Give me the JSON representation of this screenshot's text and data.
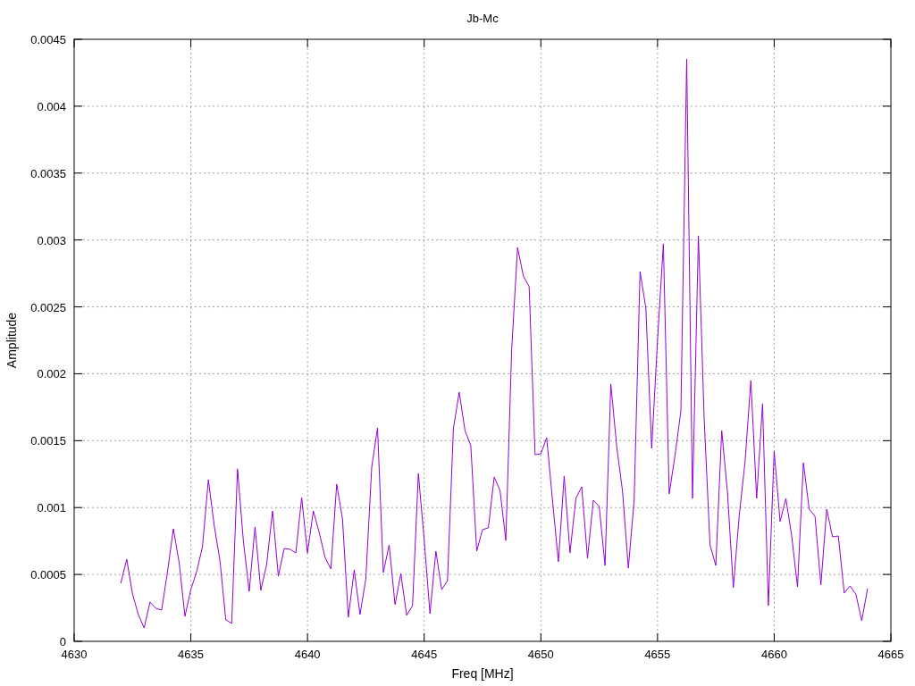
{
  "chart_data": {
    "type": "line",
    "title": "Jb-Mc",
    "xlabel": "Freq [MHz]",
    "ylabel": "Amplitude",
    "x": [
      4632,
      4632.25,
      4632.5,
      4632.75,
      4633,
      4633.25,
      4633.5,
      4633.75,
      4634,
      4634.25,
      4634.5,
      4634.75,
      4635,
      4635.25,
      4635.5,
      4635.75,
      4636,
      4636.25,
      4636.5,
      4636.75,
      4637,
      4637.25,
      4637.5,
      4637.75,
      4638,
      4638.25,
      4638.5,
      4638.75,
      4639,
      4639.25,
      4639.5,
      4639.75,
      4640,
      4640.25,
      4640.5,
      4640.75,
      4641,
      4641.25,
      4641.5,
      4641.75,
      4642,
      4642.25,
      4642.5,
      4642.75,
      4643,
      4643.25,
      4643.5,
      4643.75,
      4644,
      4644.25,
      4644.5,
      4644.75,
      4645,
      4645.25,
      4645.5,
      4645.75,
      4646,
      4646.25,
      4646.5,
      4646.75,
      4647,
      4647.25,
      4647.5,
      4647.75,
      4648,
      4648.25,
      4648.5,
      4648.75,
      4649,
      4649.25,
      4649.5,
      4649.75,
      4650,
      4650.25,
      4650.5,
      4650.75,
      4651,
      4651.25,
      4651.5,
      4651.75,
      4652,
      4652.25,
      4652.5,
      4652.75,
      4653,
      4653.25,
      4653.5,
      4653.75,
      4654,
      4654.25,
      4654.5,
      4654.75,
      4655,
      4655.25,
      4655.5,
      4655.75,
      4656,
      4656.25,
      4656.5,
      4656.75,
      4657,
      4657.25,
      4657.5,
      4657.75,
      4658,
      4658.25,
      4658.5,
      4658.75,
      4659,
      4659.25,
      4659.5,
      4659.75,
      4660,
      4660.25,
      4660.5,
      4660.75,
      4661,
      4661.25,
      4661.5,
      4661.75,
      4662,
      4662.25,
      4662.5,
      4662.75,
      4663,
      4663.25,
      4663.5,
      4663.75,
      4664
    ],
    "series": [
      {
        "color": "#9400d3",
        "values": [
          0.000434,
          0.000614,
          0.000354,
          0.0002,
          0.0001,
          0.000294,
          0.000247,
          0.000234,
          0.000521,
          0.000841,
          0.000588,
          0.000187,
          0.000387,
          0.000521,
          0.000708,
          0.001208,
          0.000868,
          0.000601,
          0.00016,
          0.000134,
          0.001289,
          0.000754,
          0.000374,
          0.000855,
          0.000381,
          0.000574,
          0.000975,
          0.000487,
          0.000694,
          0.000688,
          0.000661,
          0.001075,
          0.000661,
          0.000975,
          0.000815,
          0.000628,
          0.000541,
          0.001175,
          0.000915,
          0.00018,
          0.000534,
          0.0002,
          0.000467,
          0.001302,
          0.001596,
          0.000514,
          0.000721,
          0.000274,
          0.000507,
          0.000194,
          0.000267,
          0.001255,
          0.000761,
          0.000207,
          0.000674,
          0.000387,
          0.000454,
          0.001589,
          0.001863,
          0.001576,
          0.001462,
          0.000674,
          0.000835,
          0.000848,
          0.001228,
          0.001128,
          0.000754,
          0.002177,
          0.002944,
          0.002731,
          0.002651,
          0.001395,
          0.001402,
          0.001522,
          0.001055,
          0.000594,
          0.001235,
          0.000661,
          0.001068,
          0.001155,
          0.000621,
          0.001055,
          0.001008,
          0.000567,
          0.001923,
          0.001455,
          0.001122,
          0.000547,
          0.001055,
          0.002764,
          0.00249,
          0.001442,
          0.002257,
          0.002971,
          0.001102,
          0.001389,
          0.001723,
          0.004353,
          0.001068,
          0.003031,
          0.001656,
          0.000721,
          0.000567,
          0.001576,
          0.001108,
          0.000401,
          0.000941,
          0.001342,
          0.00195,
          0.001068,
          0.001776,
          0.000267,
          0.001422,
          0.000895,
          0.001068,
          0.000788,
          0.000407,
          0.001335,
          0.000988,
          0.000935,
          0.000421,
          0.000988,
          0.000781,
          0.000788,
          0.000361,
          0.000414,
          0.000354,
          0.000154,
          0.000394
        ]
      }
    ],
    "grid": true,
    "xlim": [
      4630,
      4665
    ],
    "ylim": [
      0,
      0.0045
    ],
    "xticks": [
      4630,
      4635,
      4640,
      4645,
      4650,
      4655,
      4660,
      4665
    ],
    "yticks": [
      {
        "value": 0,
        "label": "0"
      },
      {
        "value": 0.0005,
        "label": "0.0005"
      },
      {
        "value": 0.001,
        "label": "0.001"
      },
      {
        "value": 0.0015,
        "label": "0.0015"
      },
      {
        "value": 0.002,
        "label": "0.002"
      },
      {
        "value": 0.0025,
        "label": "0.0025"
      },
      {
        "value": 0.003,
        "label": "0.003"
      },
      {
        "value": 0.0035,
        "label": "0.0035"
      },
      {
        "value": 0.004,
        "label": "0.004"
      },
      {
        "value": 0.0045,
        "label": "0.0045"
      }
    ]
  }
}
